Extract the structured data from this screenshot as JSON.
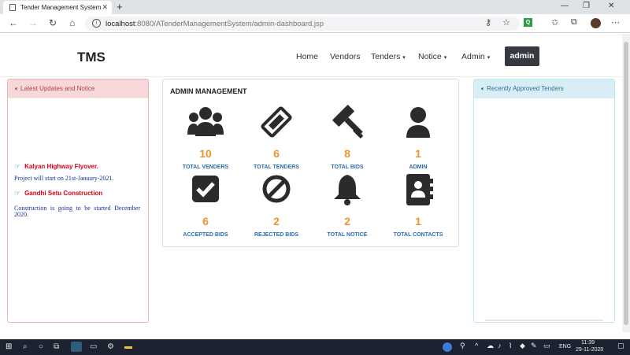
{
  "browser": {
    "tab_title": "Tender Management System",
    "url_host": "localhost",
    "url_rest": ":8080/ATenderManagementSystem/admin-dashboard.jsp"
  },
  "nav": {
    "brand": "TMS",
    "home": "Home",
    "vendors": "Vendors",
    "tenders": "Tenders",
    "notice": "Notice",
    "admin": "Admin",
    "user_button": "admin"
  },
  "left_panel": {
    "title": "Latest Updates and Notice",
    "items": [
      {
        "title": "Kalyan Highway Flyover.",
        "text": "Project will start on 21st-January-2021."
      },
      {
        "title": "Gandhi Setu Construction",
        "text": "Construction is going to be started December 2020."
      }
    ]
  },
  "center_panel": {
    "title": "ADMIN MANAGEMENT",
    "cards": [
      {
        "icon": "users-icon",
        "count": "10",
        "label": "TOTAL VENDERS"
      },
      {
        "icon": "ticket-icon",
        "count": "6",
        "label": "TOTAL TENDERS"
      },
      {
        "icon": "gavel-icon",
        "count": "8",
        "label": "TOTAL BIDS"
      },
      {
        "icon": "user-icon",
        "count": "1",
        "label": "ADMIN"
      },
      {
        "icon": "check-square-icon",
        "count": "6",
        "label": "ACCEPTED BIDS"
      },
      {
        "icon": "ban-icon",
        "count": "2",
        "label": "REJECTED BIDS"
      },
      {
        "icon": "bell-icon",
        "count": "2",
        "label": "TOTAL NOTICE"
      },
      {
        "icon": "address-book-icon",
        "count": "1",
        "label": "TOTAL CONTACTS"
      }
    ]
  },
  "right_panel": {
    "title": "Recently Approved Tenders"
  },
  "taskbar": {
    "lang": "ENG",
    "time": "11:39",
    "date": "29-11-2020"
  },
  "colors": {
    "accent_count": "#f0932b",
    "label_blue": "#2a6db0",
    "notice_red": "#d9001b",
    "admin_btn": "#343a40"
  }
}
